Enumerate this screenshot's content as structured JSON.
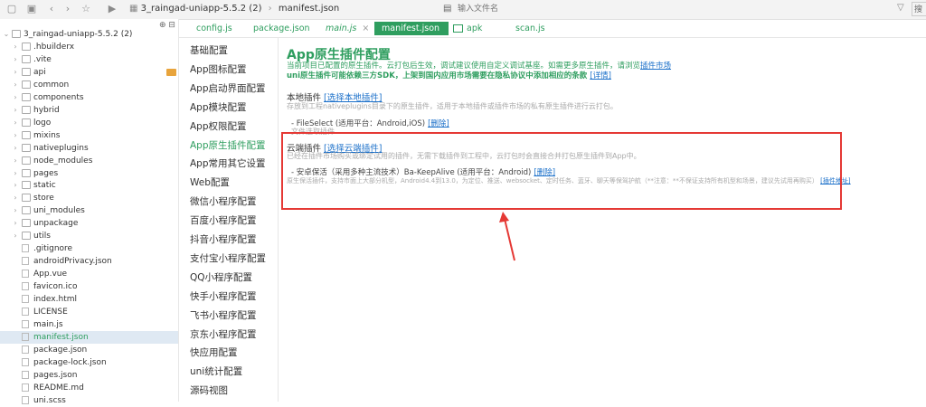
{
  "toolbar": {
    "crumb_project": "3_raingad-uniapp-5.5.2 (2)",
    "crumb_file": "manifest.json",
    "file_input_placeholder": "输入文件名",
    "right_box": "搜"
  },
  "explorer": {
    "root_label": "3_raingad-uniapp-5.5.2 (2)",
    "items": [
      {
        "label": ".hbuilderx",
        "type": "folder"
      },
      {
        "label": ".vite",
        "type": "folder"
      },
      {
        "label": "api",
        "type": "folder"
      },
      {
        "label": "common",
        "type": "folder"
      },
      {
        "label": "components",
        "type": "folder"
      },
      {
        "label": "hybrid",
        "type": "folder"
      },
      {
        "label": "logo",
        "type": "folder"
      },
      {
        "label": "mixins",
        "type": "folder"
      },
      {
        "label": "nativeplugins",
        "type": "folder"
      },
      {
        "label": "node_modules",
        "type": "folder"
      },
      {
        "label": "pages",
        "type": "folder"
      },
      {
        "label": "static",
        "type": "folder"
      },
      {
        "label": "store",
        "type": "folder"
      },
      {
        "label": "uni_modules",
        "type": "folder"
      },
      {
        "label": "unpackage",
        "type": "folder"
      },
      {
        "label": "utils",
        "type": "folder"
      },
      {
        "label": ".gitignore",
        "type": "file"
      },
      {
        "label": "androidPrivacy.json",
        "type": "file"
      },
      {
        "label": "App.vue",
        "type": "file"
      },
      {
        "label": "favicon.ico",
        "type": "file"
      },
      {
        "label": "index.html",
        "type": "file"
      },
      {
        "label": "LICENSE",
        "type": "file"
      },
      {
        "label": "main.js",
        "type": "file"
      },
      {
        "label": "manifest.json",
        "type": "file"
      },
      {
        "label": "package.json",
        "type": "file"
      },
      {
        "label": "package-lock.json",
        "type": "file"
      },
      {
        "label": "pages.json",
        "type": "file"
      },
      {
        "label": "README.md",
        "type": "file"
      },
      {
        "label": "uni.scss",
        "type": "file"
      }
    ]
  },
  "tabs": [
    {
      "label": "config.js"
    },
    {
      "label": "package.json"
    },
    {
      "label": "main.js",
      "close": "×"
    },
    {
      "label": "manifest.json"
    },
    {
      "label": "apk"
    },
    {
      "label": "scan.js"
    }
  ],
  "settings_nav": [
    {
      "label": "基础配置"
    },
    {
      "label": "App图标配置"
    },
    {
      "label": "App启动界面配置"
    },
    {
      "label": "App模块配置"
    },
    {
      "label": "App权限配置"
    },
    {
      "label": "App原生插件配置"
    },
    {
      "label": "App常用其它设置"
    },
    {
      "label": "Web配置"
    },
    {
      "label": "微信小程序配置"
    },
    {
      "label": "百度小程序配置"
    },
    {
      "label": "抖音小程序配置"
    },
    {
      "label": "支付宝小程序配置"
    },
    {
      "label": "QQ小程序配置"
    },
    {
      "label": "快手小程序配置"
    },
    {
      "label": "飞书小程序配置"
    },
    {
      "label": "京东小程序配置"
    },
    {
      "label": "快应用配置"
    },
    {
      "label": "uni统计配置"
    },
    {
      "label": "源码视图"
    }
  ],
  "main": {
    "title": "App原生插件配置",
    "desc1": "当前项目已配置的原生插件。云打包后生效，调试建议使用自定义调试基座。如需更多原生插件，请浏览",
    "desc1_link": "插件市场",
    "desc2": "uni原生插件可能依赖三方SDK，上架到国内应用市场需要在隐私协议中添加相应的条款",
    "desc2_link": "[详情]",
    "local_title": "本地插件",
    "local_link": "[选择本地插件]",
    "local_hint": "存放到工程nativeplugins目录下的原生插件，适用于本地插件或插件市场的私有原生插件进行云打包。",
    "local_item": "- FileSelect (适用平台：Android,iOS)",
    "local_item_del": "[删除]",
    "local_item_hint": "文件选取插件",
    "cloud_title": "云端插件",
    "cloud_link": "[选择云端插件]",
    "cloud_hint": "已经在插件市场购买或绑定试用的插件，无需下载插件到工程中，云打包时会直接合并打包原生插件到App中。",
    "cloud_item": "- 安卓保活（采用多种主流技术）Ba-KeepAlive (适用平台：Android)",
    "cloud_item_del": "[删除]",
    "cloud_item_desc": "原生保活插件，支持市面上大部分机型，Android4.4到13.0，为定位、推送、websocket、定时任务、蓝牙、聊天等保驾护航（**注意：**不保证支持所有机型和场景，建议先试用再购买）",
    "cloud_item_link": "[插件地址]"
  }
}
